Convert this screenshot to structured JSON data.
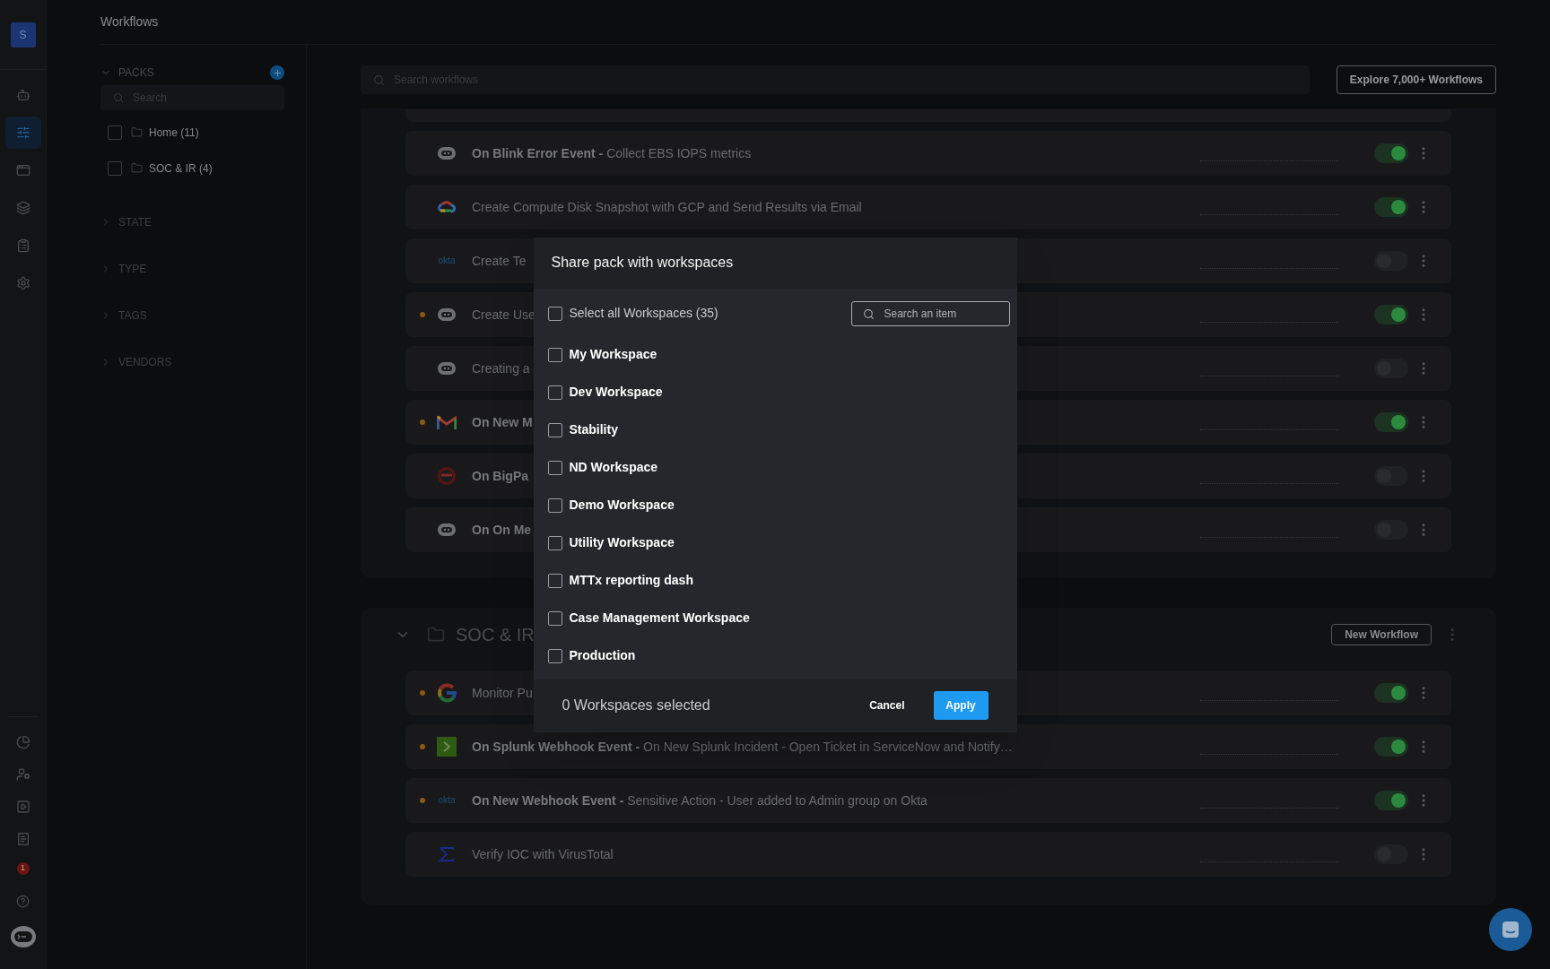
{
  "rail": {
    "avatar": "S",
    "top_items": [
      {
        "kind": "bot",
        "selected": false
      },
      {
        "kind": "sliders",
        "selected": true
      },
      {
        "kind": "calendar",
        "selected": false
      },
      {
        "kind": "layers",
        "selected": false
      },
      {
        "kind": "clipboard",
        "selected": false
      },
      {
        "kind": "settings",
        "selected": false
      }
    ],
    "bottom_items": [
      {
        "kind": "chart",
        "selected": false
      },
      {
        "kind": "user",
        "selected": false
      },
      {
        "kind": "play",
        "selected": false
      },
      {
        "kind": "receipt",
        "selected": false
      }
    ],
    "notification_count": "1"
  },
  "page_title": "Workflows",
  "filters": {
    "packs_label": "PACKS",
    "packs_expanded": true,
    "search_placeholder": "Search",
    "packs": [
      {
        "label": "Home (11)",
        "checked": false
      },
      {
        "label": "SOC & IR (4)",
        "checked": false
      }
    ],
    "sections": [
      {
        "label": "STATE",
        "expanded": false
      },
      {
        "label": "TYPE",
        "expanded": false
      },
      {
        "label": "TAGS",
        "expanded": false
      },
      {
        "label": "VENDORS",
        "expanded": false
      }
    ]
  },
  "search_placeholder": "Search workflows",
  "explore_button": "Explore 7,000+ Workflows",
  "groups": [
    {
      "workflows": [
        {
          "kind": "blink",
          "trigger": "On Blink Error Event - ",
          "title": "Collect EBS IOPS metrics",
          "flagged": false,
          "on": true
        },
        {
          "kind": "gcp",
          "title": "Create Compute Disk Snapshot with GCP and Send Results via Email",
          "flagged": false,
          "on": true
        },
        {
          "kind": "okta",
          "logo": "okta",
          "title": "Create Te",
          "flagged": false,
          "on": false
        },
        {
          "kind": "blink",
          "title": "Create Use",
          "flagged": true,
          "on": true
        },
        {
          "kind": "blink",
          "title": "Creating a",
          "flagged": false,
          "on": false
        },
        {
          "kind": "gmail",
          "trigger": "On New M",
          "flagged": true,
          "on": true
        },
        {
          "kind": "bigpanda",
          "trigger": "On BigPa",
          "flagged": false,
          "on": false
        },
        {
          "kind": "blink",
          "trigger": "On On Me",
          "flagged": false,
          "on": false
        }
      ]
    },
    {
      "name": "SOC & IR",
      "expanded": true,
      "new_button": "New Workflow",
      "workflows": [
        {
          "kind": "google",
          "title": "Monitor Pu",
          "flagged": true,
          "on": true
        },
        {
          "kind": "splunk",
          "trigger": "On Splunk Webhook Event - ",
          "title": "On New Splunk Incident - Open Ticket in ServiceNow and Notify…",
          "flagged": true,
          "on": true
        },
        {
          "kind": "okta",
          "logo": "okta",
          "trigger": "On New Webhook Event - ",
          "title": "Sensitive Action - User added to Admin group on Okta",
          "flagged": true,
          "on": true
        },
        {
          "kind": "virustotal",
          "title": "Verify IOC with VirusTotal",
          "flagged": false,
          "on": false
        }
      ]
    }
  ],
  "dialog": {
    "title": "Share pack with workspaces",
    "select_all": {
      "label": "Select all Workspaces (35)",
      "checked": false
    },
    "search_placeholder": "Search an item",
    "workspaces": [
      {
        "label": "My Workspace",
        "checked": false
      },
      {
        "label": "Dev Workspace",
        "checked": false
      },
      {
        "label": "Stability",
        "checked": false
      },
      {
        "label": "ND Workspace",
        "checked": false
      },
      {
        "label": "Demo Workspace",
        "checked": false
      },
      {
        "label": "Utility Workspace",
        "checked": false
      },
      {
        "label": "MTTx reporting dash",
        "checked": false
      },
      {
        "label": "Case Management Workspace",
        "checked": false
      },
      {
        "label": "Production",
        "checked": false
      }
    ],
    "selected_count": "0 Workspaces selected",
    "cancel": "Cancel",
    "apply": "Apply"
  }
}
